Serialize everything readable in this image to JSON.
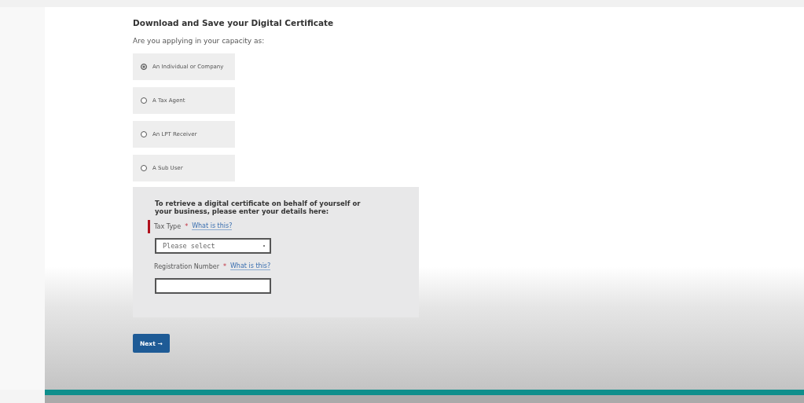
{
  "heading": "Download and Save your Digital Certificate",
  "question": "Are you applying in your capacity as:",
  "options": [
    {
      "label": "An Individual or Company",
      "selected": true
    },
    {
      "label": "A Tax Agent",
      "selected": false
    },
    {
      "label": "An LPT Receiver",
      "selected": false
    },
    {
      "label": "A Sub User",
      "selected": false
    }
  ],
  "panel": {
    "intro": "To retrieve a digital certificate on behalf of yourself or your business, please enter your details here:",
    "fields": [
      {
        "kind": "select",
        "label": "Tax Type",
        "required": "*",
        "help": "What is this?",
        "placeholder": "Please select",
        "flagged": true
      },
      {
        "kind": "text",
        "label": "Registration Number",
        "required": "*",
        "help": "What is this?",
        "flagged": false
      }
    ]
  },
  "next_button": {
    "label": "Next",
    "icon": "→"
  }
}
